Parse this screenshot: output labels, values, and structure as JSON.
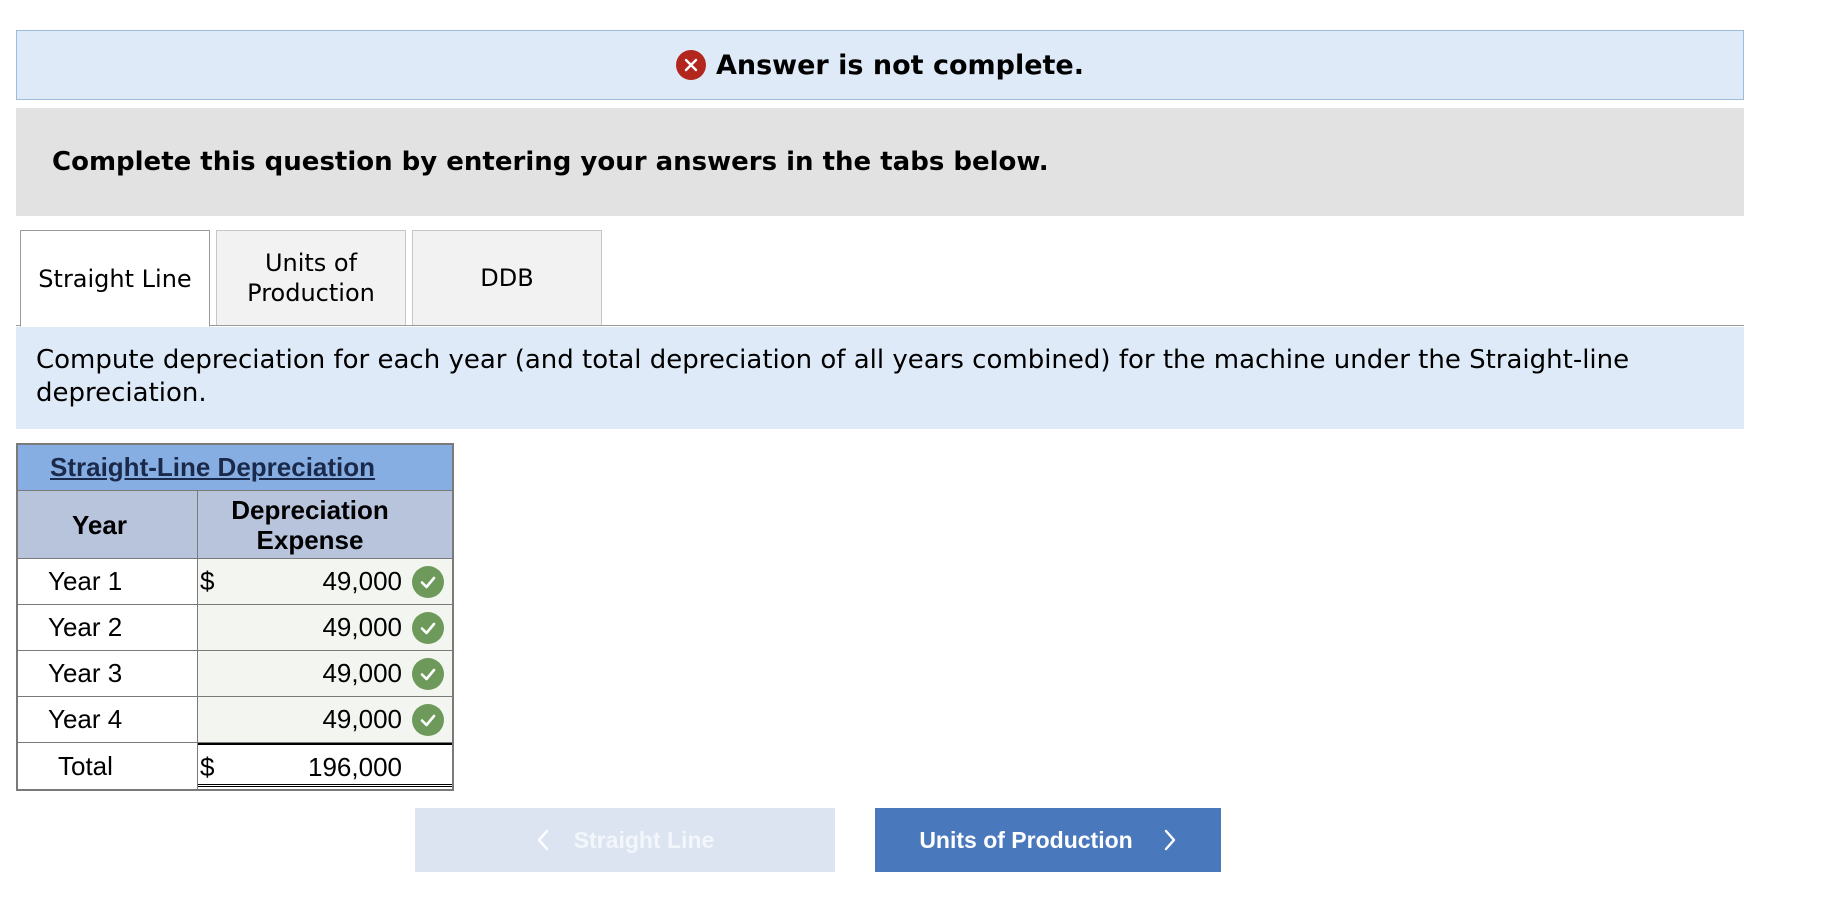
{
  "banner": {
    "text": "Answer is not complete.",
    "icon": "x-circle-icon",
    "icon_color": "#b3261e"
  },
  "instructions": "Complete this question by entering your answers in the tabs below.",
  "tabs": [
    {
      "label": "Straight Line",
      "active": true
    },
    {
      "label": "Units of\nProduction",
      "active": false
    },
    {
      "label": "DDB",
      "active": false
    }
  ],
  "prompt": "Compute depreciation for each year (and total depreciation of all years combined) for the machine under the Straight-line depreciation.",
  "table": {
    "title": "Straight-Line Depreciation",
    "headers": [
      "Year",
      "Depreciation Expense"
    ],
    "rows": [
      {
        "year": "Year 1",
        "currency": "$",
        "value": "49,000",
        "correct": true
      },
      {
        "year": "Year 2",
        "currency": "",
        "value": "49,000",
        "correct": true
      },
      {
        "year": "Year 3",
        "currency": "",
        "value": "49,000",
        "correct": true
      },
      {
        "year": "Year 4",
        "currency": "",
        "value": "49,000",
        "correct": true
      }
    ],
    "total": {
      "label": "Total",
      "currency": "$",
      "value": "196,000"
    }
  },
  "nav": {
    "prev_label": "Straight Line",
    "next_label": "Units of Production"
  },
  "colors": {
    "check": "#6d9a5b",
    "next_button": "#4a78bd",
    "prev_button_disabled": "#dbe4f0"
  }
}
